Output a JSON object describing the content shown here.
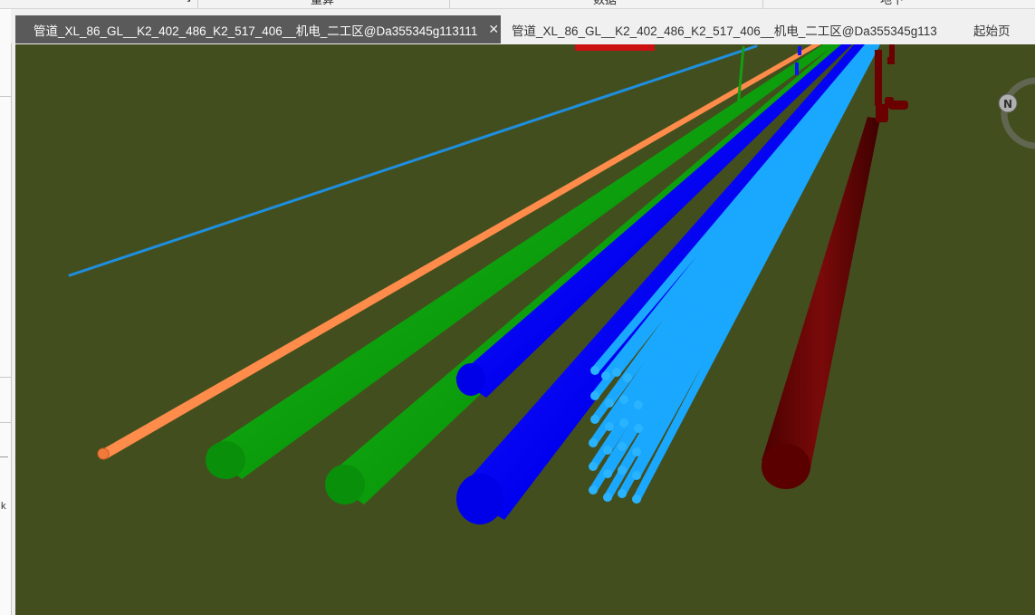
{
  "ribbon": {
    "group_labels": [
      "量算",
      "数据",
      "地下"
    ]
  },
  "tabs": [
    {
      "label": "管道_XL_86_GL__K2_402_486_K2_517_406__机电_二工区@Da355345g113111",
      "active": true,
      "close_icon": "✕"
    },
    {
      "label": "管道_XL_86_GL__K2_402_486_K2_517_406__机电_二工区@Da355345g113",
      "active": false
    },
    {
      "label": "起始页",
      "active": false
    }
  ],
  "left_panel": {
    "partial_text": "k"
  },
  "viewport": {
    "background": "#434e1e",
    "compass_letter": "N",
    "pipe_colors": {
      "blue_line": "#1e8fe0",
      "orange": "#ff8c4a",
      "green": "#0a9a0a",
      "blue": "#0000ff",
      "light_blue": "#1aa8ff",
      "dark_red": "#6b0000"
    }
  }
}
